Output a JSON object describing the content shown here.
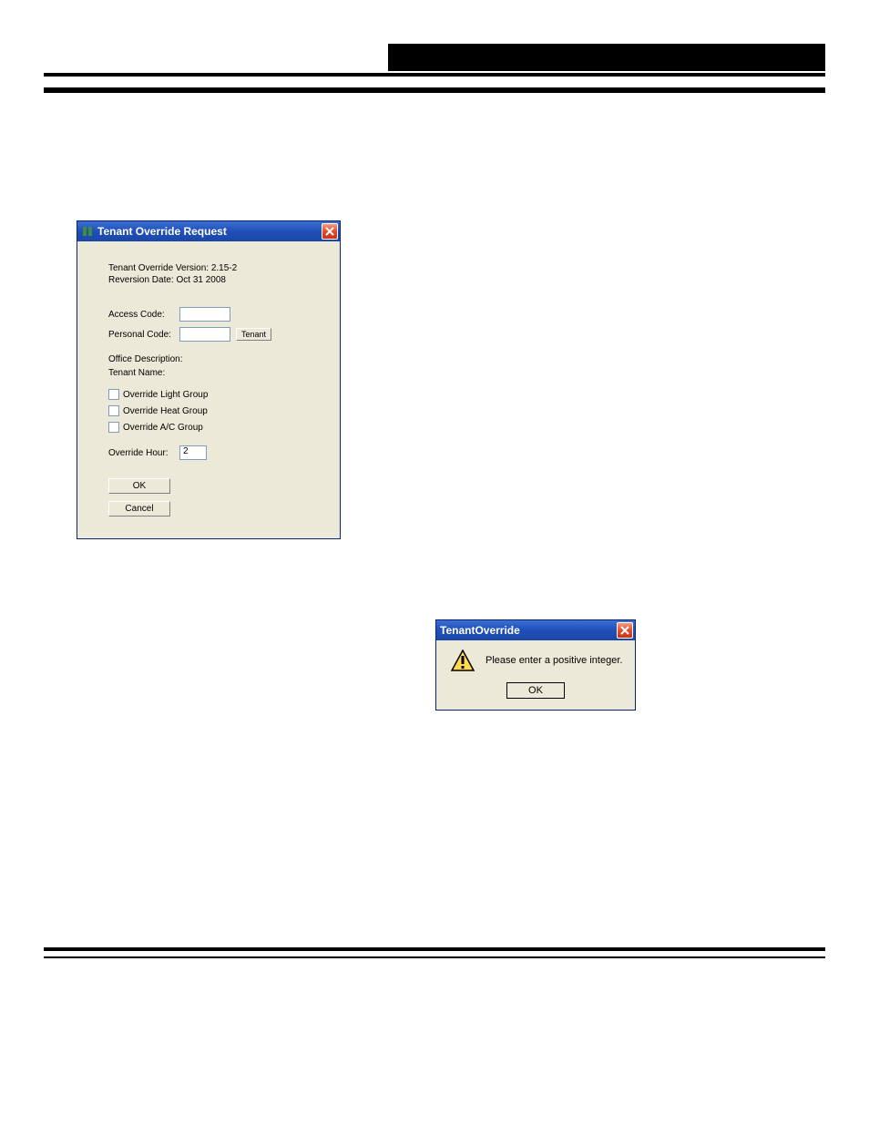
{
  "win1": {
    "title": "Tenant Override Request",
    "info_version": "Tenant Override Version: 2.15-2",
    "info_date": "Reversion Date: Oct 31 2008",
    "access_label": "Access Code:",
    "personal_label": "Personal Code:",
    "tenant_button": "Tenant",
    "office_label": "Office Description:",
    "name_label": "Tenant Name:",
    "cb_light": "Override Light Group",
    "cb_heat": "Override Heat Group",
    "cb_ac": "Override A/C Group",
    "hour_label": "Override Hour:",
    "hour_value": "2",
    "ok": "OK",
    "cancel": "Cancel"
  },
  "msgbox": {
    "title": "TenantOverride",
    "message": "Please enter a positive integer.",
    "ok": "OK"
  }
}
